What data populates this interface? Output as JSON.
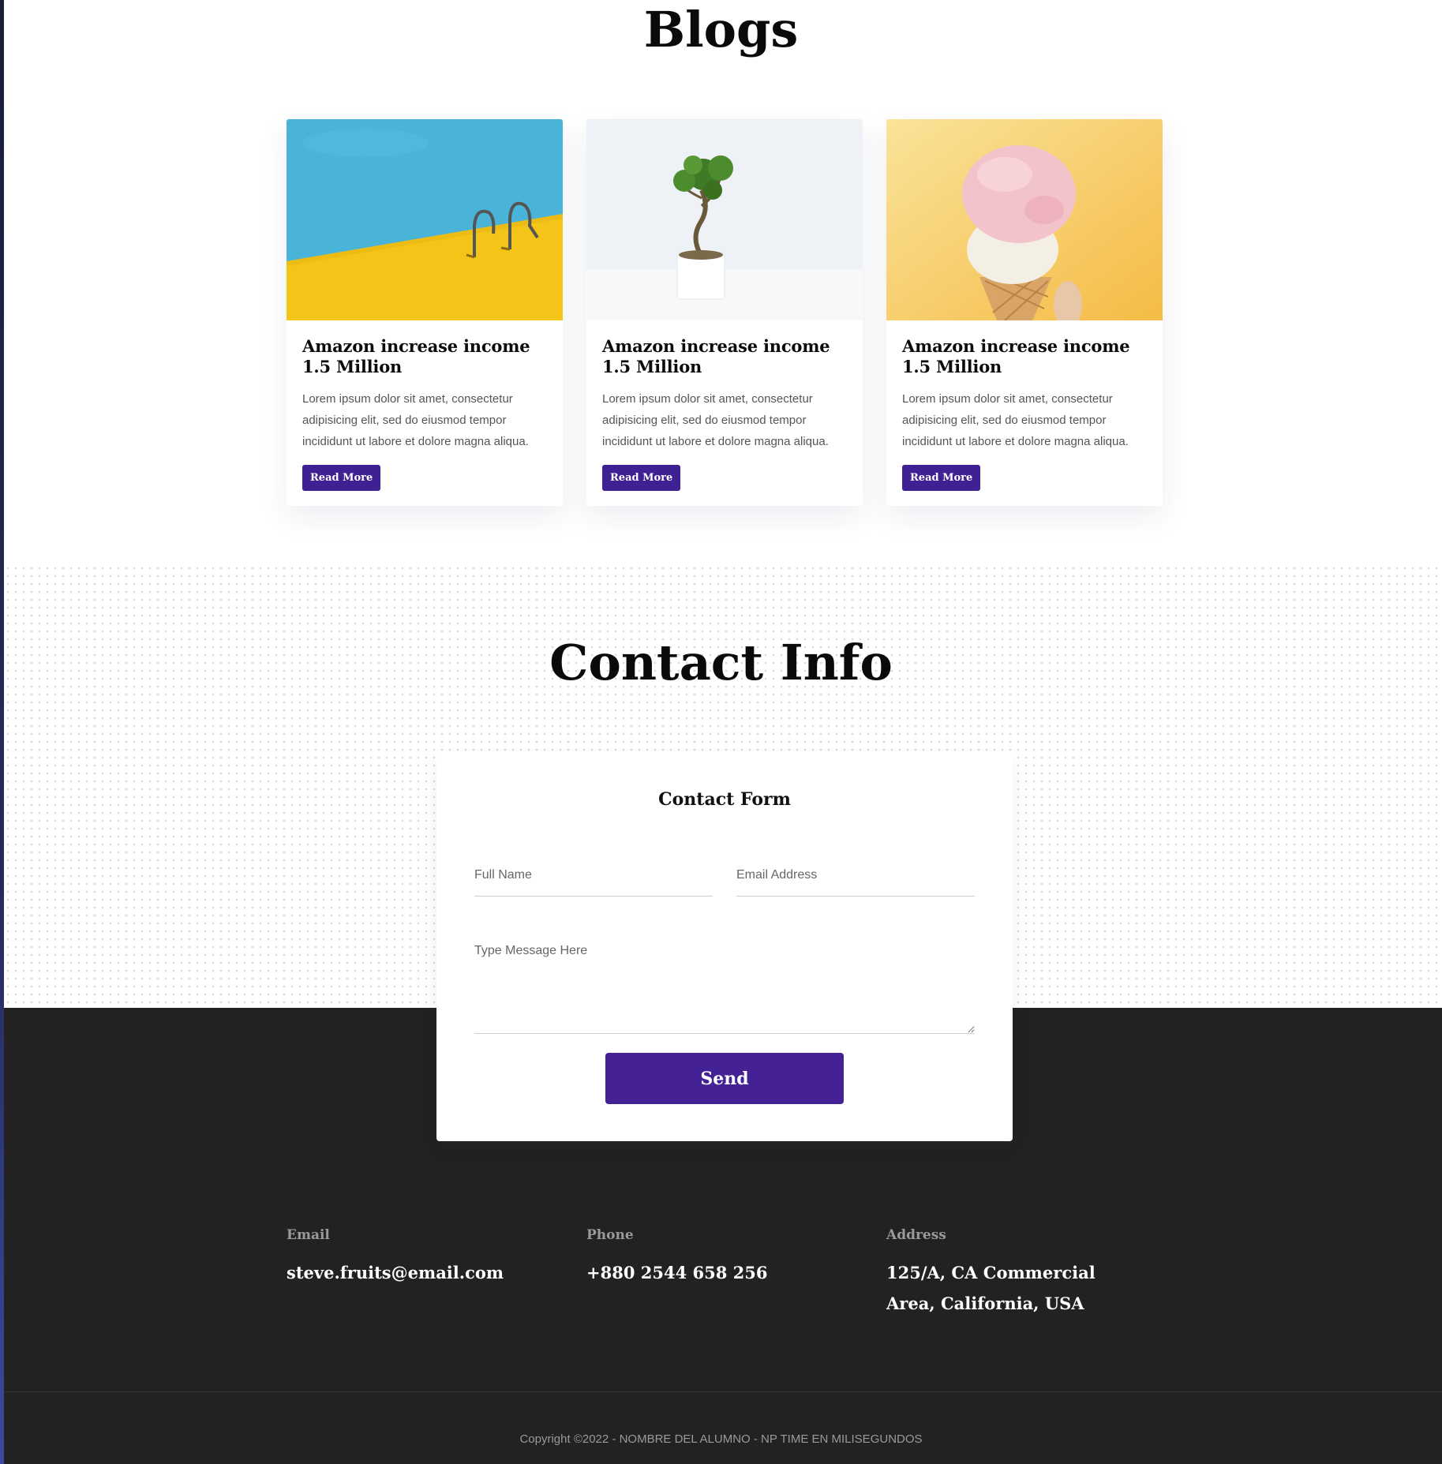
{
  "blogs": {
    "title": "Blogs",
    "posts": [
      {
        "image": "swimming-pool-ladder-photo",
        "title": "Amazon increase income 1.5 Million",
        "excerpt": "Lorem ipsum dolor sit amet, consectetur adipisicing elit, sed do eiusmod tempor incididunt ut labore et dolore magna aliqua.",
        "button": "Read More"
      },
      {
        "image": "bonsai-plant-photo",
        "title": "Amazon increase income 1.5 Million",
        "excerpt": "Lorem ipsum dolor sit amet, consectetur adipisicing elit, sed do eiusmod tempor incididunt ut labore et dolore magna aliqua.",
        "button": "Read More"
      },
      {
        "image": "ice-cream-cone-photo",
        "title": "Amazon increase income 1.5 Million",
        "excerpt": "Lorem ipsum dolor sit amet, consectetur adipisicing elit, sed do eiusmod tempor incididunt ut labore et dolore magna aliqua.",
        "button": "Read More"
      }
    ]
  },
  "contact": {
    "title": "Contact Info",
    "form": {
      "title": "Contact Form",
      "name_placeholder": "Full Name",
      "email_placeholder": "Email Address",
      "message_placeholder": "Type Message Here",
      "send_label": "Send"
    },
    "info": [
      {
        "label": "Email",
        "value": "steve.fruits@email.com"
      },
      {
        "label": "Phone",
        "value": "+880 2544 658 256"
      },
      {
        "label": "Address",
        "value": "125/A, CA Commercial Area, California, USA"
      }
    ]
  },
  "footer": {
    "copyright": "Copyright ©2022 - NOMBRE DEL ALUMNO - NP TIME EN MILISEGUNDOS"
  },
  "colors": {
    "accent": "#3f2193",
    "footer_bg": "#222222"
  }
}
